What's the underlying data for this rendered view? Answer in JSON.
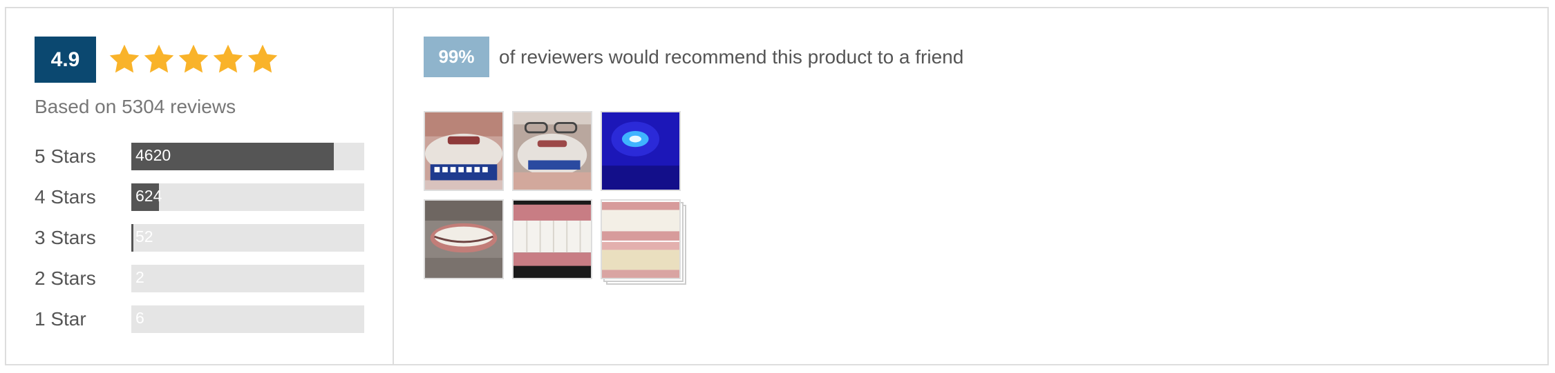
{
  "summary": {
    "average_rating": "4.9",
    "star_count": 5,
    "based_on": "Based on 5304 reviews",
    "accent_color": "#0b4870",
    "star_color": "#f9b32a"
  },
  "breakdown": [
    {
      "label": "5 Stars",
      "count": "4620",
      "fraction": 0.87
    },
    {
      "label": "4 Stars",
      "count": "624",
      "fraction": 0.118
    },
    {
      "label": "3 Stars",
      "count": "52",
      "fraction": 0.01
    },
    {
      "label": "2 Stars",
      "count": "2",
      "fraction": 0.0004
    },
    {
      "label": "1 Star",
      "count": "6",
      "fraction": 0.001
    }
  ],
  "recommendation": {
    "percent": "99%",
    "text": "of reviewers would recommend this product to a friend",
    "badge_color": "#8fb4cc"
  },
  "photos": [
    {
      "name": "review-photo-shade-guide-beard"
    },
    {
      "name": "review-photo-shade-guide-glasses"
    },
    {
      "name": "review-photo-blue-led-mouthpiece"
    },
    {
      "name": "review-photo-smile-beard"
    },
    {
      "name": "review-photo-teeth-closeup"
    },
    {
      "name": "review-photo-before-after-stack"
    }
  ]
}
